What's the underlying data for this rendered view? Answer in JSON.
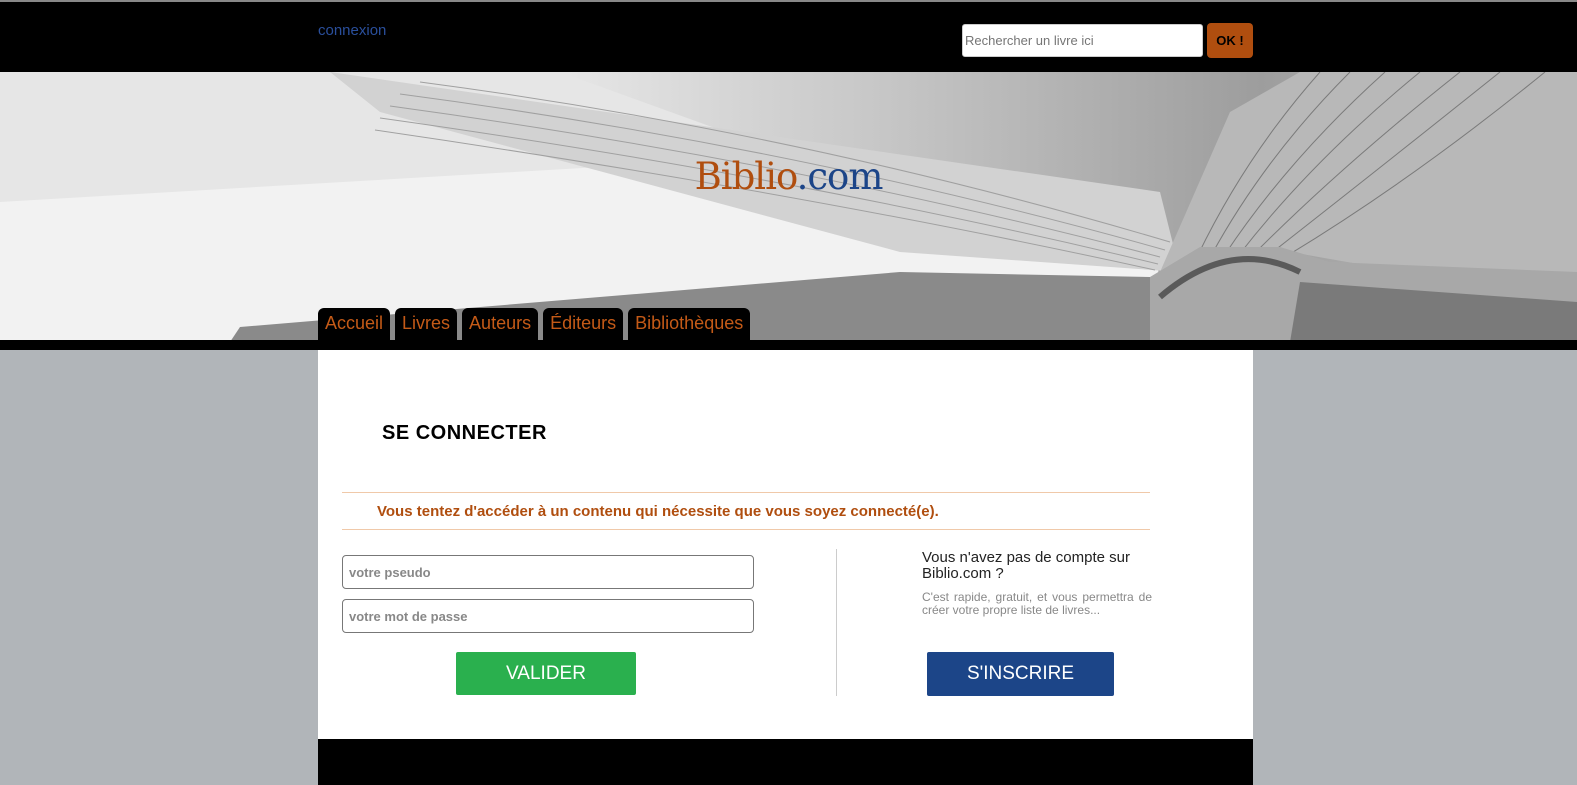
{
  "header": {
    "login_link": "connexion",
    "search_placeholder": "Rechercher un livre ici",
    "search_button": "OK !"
  },
  "banner": {
    "logo_brand": "Biblio",
    "logo_tld": ".com"
  },
  "nav": {
    "tabs": [
      {
        "label": "Accueil"
      },
      {
        "label": "Livres"
      },
      {
        "label": "Auteurs"
      },
      {
        "label": "Éditeurs"
      },
      {
        "label": "Bibliothèques"
      }
    ]
  },
  "login": {
    "title": "SE CONNECTER",
    "notice": "Vous tentez d'accéder à un contenu qui nécessite que vous soyez connecté(e).",
    "pseudo_placeholder": "votre pseudo",
    "password_placeholder": "votre mot de passe",
    "submit_label": "VALIDER"
  },
  "signup": {
    "title": "Vous n'avez pas de compte sur Biblio.com ?",
    "description": "C'est rapide, gratuit, et vous permettra de créer votre propre liste de livres...",
    "button_label": "S'INSCRIRE"
  },
  "colors": {
    "accent_orange": "#b04e0f",
    "brand_blue": "#1c4588",
    "validate_green": "#2ab04e",
    "page_background": "#b1b5b9"
  }
}
